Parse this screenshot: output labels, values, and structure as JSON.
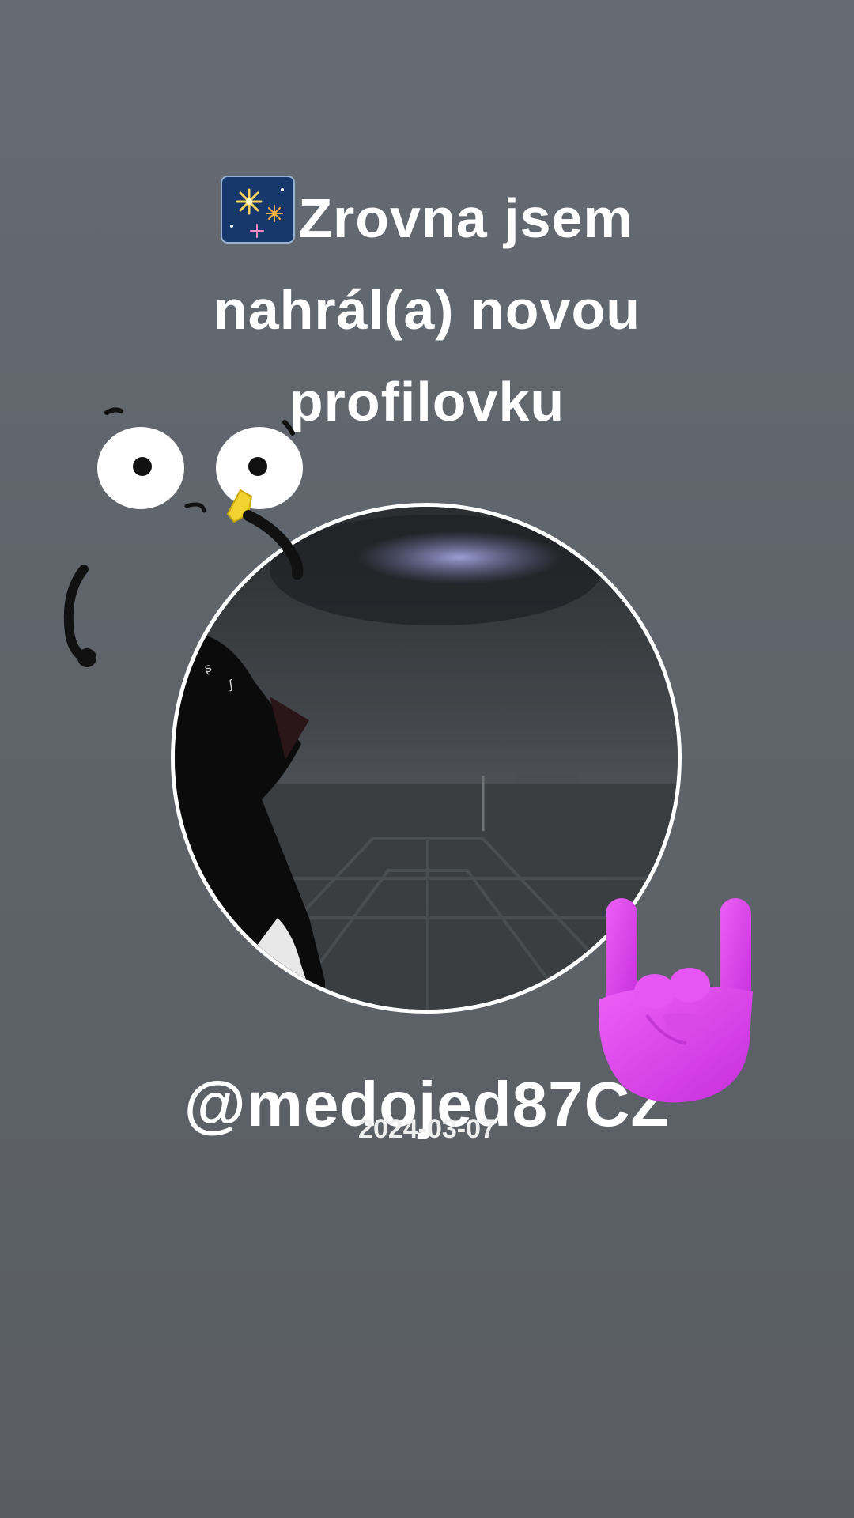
{
  "post": {
    "headline": "Zrovna jsem nahrál(a) novou profilovku",
    "username": "@medojed87CZ",
    "date": "2024-03-07"
  },
  "stickers": {
    "headline_icon": "fireworks-icon",
    "face_doodle": "cartoon-face-doodle",
    "hand_emoji": "rock-on-hand-icon"
  },
  "colors": {
    "background": "#62676e",
    "text": "#ffffff",
    "ring": "#ffffff",
    "hand": "#d63be8"
  }
}
